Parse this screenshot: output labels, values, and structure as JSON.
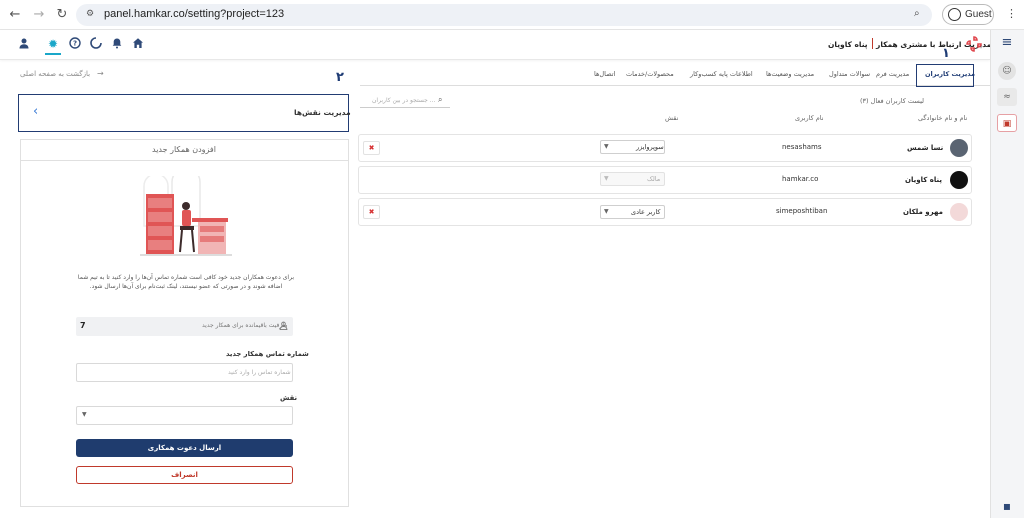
{
  "browser": {
    "url": "panel.hamkar.co/setting?project=123",
    "profile_label": "Guest"
  },
  "header": {
    "title": "پنل مدیریت ارتباط با مشتری همکار",
    "company": "پناه کاویان",
    "marker_1": "۱"
  },
  "tabs": [
    {
      "label": "مدیریت کاربران",
      "active": true
    },
    {
      "label": "مدیریت فرم"
    },
    {
      "label": "سوالات متداول"
    },
    {
      "label": "مدیریت وضعیت‌ها"
    },
    {
      "label": "اطلاعات پایه کسب‌وکار"
    },
    {
      "label": "محصولات/خدمات"
    },
    {
      "label": "اتصال‌ها"
    }
  ],
  "back_link": "بازگشت به صفحه اصلی",
  "marker_2": "۲",
  "users": {
    "count_label": "لیست کاربران فعال (۳)",
    "search_placeholder": "جستجو در بین کاربران ...",
    "columns": {
      "name": "نام و نام خانوادگی",
      "username": "نام کاربری",
      "role": "نقش"
    },
    "rows": [
      {
        "name": "نسا شمس",
        "username": "nesashams",
        "role": "سوپروایزر"
      },
      {
        "name": "پناه کاویان",
        "username": "hamkar.co",
        "role": "مالک"
      },
      {
        "name": "مهرو ملکان",
        "username": "simeposhtiban",
        "role": "کاربر عادی"
      }
    ]
  },
  "roles_panel": {
    "title": "مدیریت نقش‌ها"
  },
  "invite": {
    "title": "افزودن همکار جدید",
    "description": "برای دعوت همکاران جدید خود کافی است شماره تماس آن‌ها را وارد کنید تا به تیم شما اضافه شوند و در صورتی که عضو نیستند، لینک ثبت‌نام برای آن‌ها ارسال شود.",
    "capacity_label": "ظرفیت باقیمانده برای همکار جدید",
    "capacity_value": "7",
    "phone_label": "شماره تماس همکار جدید",
    "phone_placeholder": "شماره تماس را وارد کنید",
    "role_label": "نقش",
    "send_button": "ارسال دعوت همکاری",
    "cancel_button": "انصراف"
  },
  "colors": {
    "brand": "#1f3c6e",
    "danger": "#c0392b",
    "accent": "#3a7bd5"
  }
}
